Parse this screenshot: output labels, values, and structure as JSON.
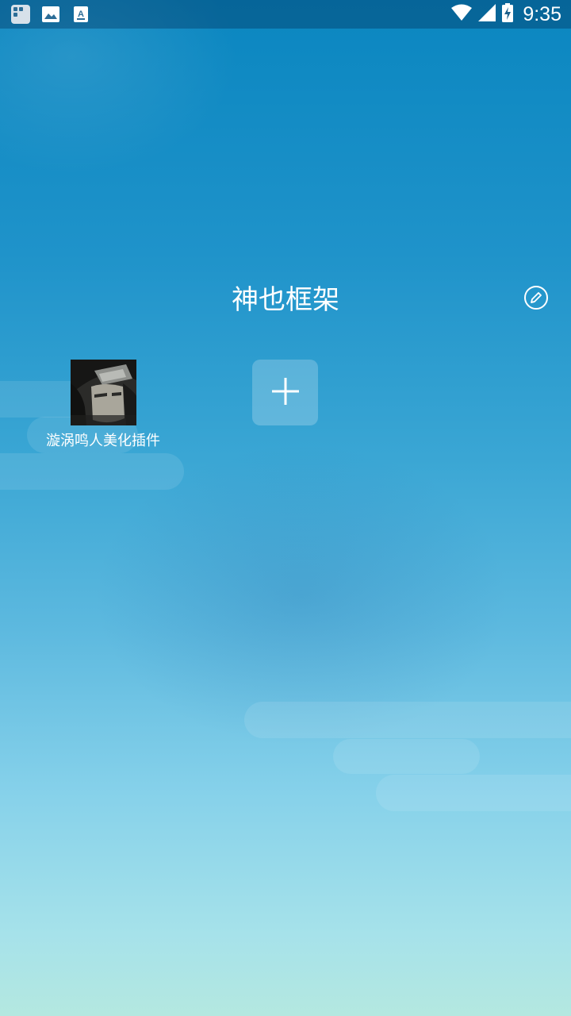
{
  "status_bar": {
    "time": "9:35",
    "left_icons": [
      "app-grid-icon",
      "image-icon",
      "keyboard-a-icon"
    ],
    "right_icons": [
      "wifi-icon",
      "cell-signal-icon",
      "battery-charging-icon"
    ]
  },
  "header": {
    "title": "神也框架",
    "edit_icon": "pencil-circle-icon"
  },
  "apps": [
    {
      "label": "漩涡鸣人美化插件",
      "icon": "anime-avatar-icon"
    }
  ],
  "add_button": {
    "icon": "plus-icon"
  },
  "colors": {
    "background_top": "#0a86c0",
    "background_bottom": "#b4e8e0",
    "text": "#ffffff"
  }
}
